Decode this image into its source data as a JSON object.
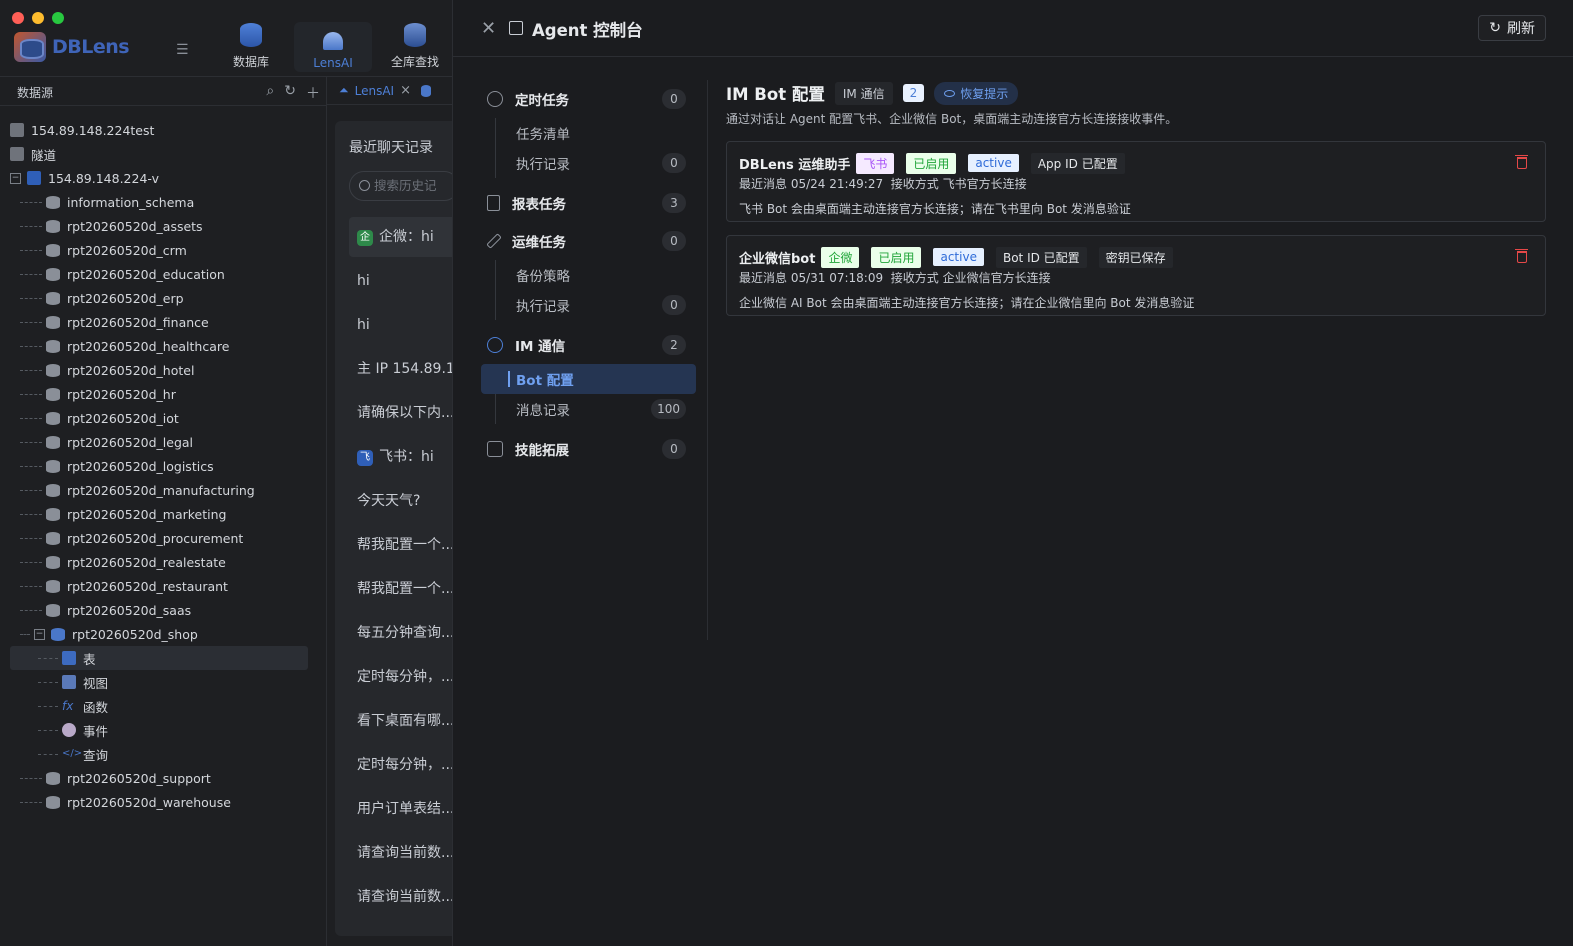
{
  "app": {
    "logo": "DBLens",
    "nav": [
      {
        "label": "数据库"
      },
      {
        "label": "LensAI"
      },
      {
        "label": "全库查找"
      }
    ],
    "datasource_title": "数据源",
    "tree": {
      "servers": [
        "154.89.148.224test",
        "隧道",
        "154.89.148.224-v"
      ],
      "databases": [
        "information_schema",
        "rpt20260520d_assets",
        "rpt20260520d_crm",
        "rpt20260520d_education",
        "rpt20260520d_erp",
        "rpt20260520d_finance",
        "rpt20260520d_healthcare",
        "rpt20260520d_hotel",
        "rpt20260520d_hr",
        "rpt20260520d_iot",
        "rpt20260520d_legal",
        "rpt20260520d_logistics",
        "rpt20260520d_manufacturing",
        "rpt20260520d_marketing",
        "rpt20260520d_procurement",
        "rpt20260520d_realestate",
        "rpt20260520d_restaurant",
        "rpt20260520d_saas",
        "rpt20260520d_shop"
      ],
      "shop_children": [
        "表",
        "视图",
        "函数",
        "事件",
        "查询"
      ],
      "after": [
        "rpt20260520d_support",
        "rpt20260520d_warehouse"
      ]
    },
    "tab_label": "LensAI",
    "chat": {
      "title": "最近聊天记录",
      "search_placeholder": "搜索历史记",
      "items": [
        {
          "badge": "企",
          "text": "企微：hi"
        },
        {
          "badge": "",
          "text": "hi"
        },
        {
          "badge": "",
          "text": "hi"
        },
        {
          "badge": "",
          "text": "主 IP 154.89.1..."
        },
        {
          "badge": "",
          "text": "请确保以下内..."
        },
        {
          "badge": "飞",
          "text": "飞书：hi"
        },
        {
          "badge": "",
          "text": "今天天气?"
        },
        {
          "badge": "",
          "text": "帮我配置一个..."
        },
        {
          "badge": "",
          "text": "帮我配置一个..."
        },
        {
          "badge": "",
          "text": "每五分钟查询..."
        },
        {
          "badge": "",
          "text": "定时每分钟，..."
        },
        {
          "badge": "",
          "text": "看下桌面有哪..."
        },
        {
          "badge": "",
          "text": "定时每分钟，..."
        },
        {
          "badge": "",
          "text": "用户订单表结..."
        },
        {
          "badge": "",
          "text": "请查询当前数..."
        },
        {
          "badge": "",
          "text": "请查询当前数..."
        }
      ]
    }
  },
  "drawer": {
    "title": "Agent 控制台",
    "refresh_label": "刷新",
    "menu": [
      {
        "label": "定时任务",
        "count": "0",
        "children": [
          {
            "label": "任务清单",
            "count": ""
          },
          {
            "label": "执行记录",
            "count": "0"
          }
        ]
      },
      {
        "label": "报表任务",
        "count": "3",
        "children": []
      },
      {
        "label": "运维任务",
        "count": "0",
        "children": [
          {
            "label": "备份策略",
            "count": ""
          },
          {
            "label": "执行记录",
            "count": "0"
          }
        ]
      },
      {
        "label": "IM 通信",
        "count": "2",
        "children": [
          {
            "label": "Bot 配置",
            "count": ""
          },
          {
            "label": "消息记录",
            "count": "100"
          }
        ]
      },
      {
        "label": "技能拓展",
        "count": "0",
        "children": []
      }
    ],
    "content": {
      "title": "IM Bot 配置",
      "tag": "IM 通信",
      "count": "2",
      "restore_hint": "恢复提示",
      "description": "通过对话让 Agent 配置飞书、企业微信 Bot，桌面端主动连接官方长连接接收事件。",
      "bots": [
        {
          "name": "DBLens 运维助手",
          "platform": "飞书",
          "enabled": "已启用",
          "status": "active",
          "id_state": "App ID 已配置",
          "secret_state": "",
          "last_msg": "最近消息 05/24 21:49:27",
          "receive": "接收方式 飞书官方长连接",
          "note": "飞书 Bot 会由桌面端主动连接官方长连接；请在飞书里向 Bot 发消息验证"
        },
        {
          "name": "企业微信bot",
          "platform": "企微",
          "enabled": "已启用",
          "status": "active",
          "id_state": "Bot ID 已配置",
          "secret_state": "密钥已保存",
          "last_msg": "最近消息 05/31 07:18:09",
          "receive": "接收方式 企业微信官方长连接",
          "note": "企业微信 AI Bot 会由桌面端主动连接官方长连接；请在企业微信里向 Bot 发消息验证"
        }
      ]
    }
  },
  "colors": {
    "accent": "#4d7fd6",
    "danger": "#e54848",
    "success": "#22a63a",
    "purple": "#a855f7"
  }
}
